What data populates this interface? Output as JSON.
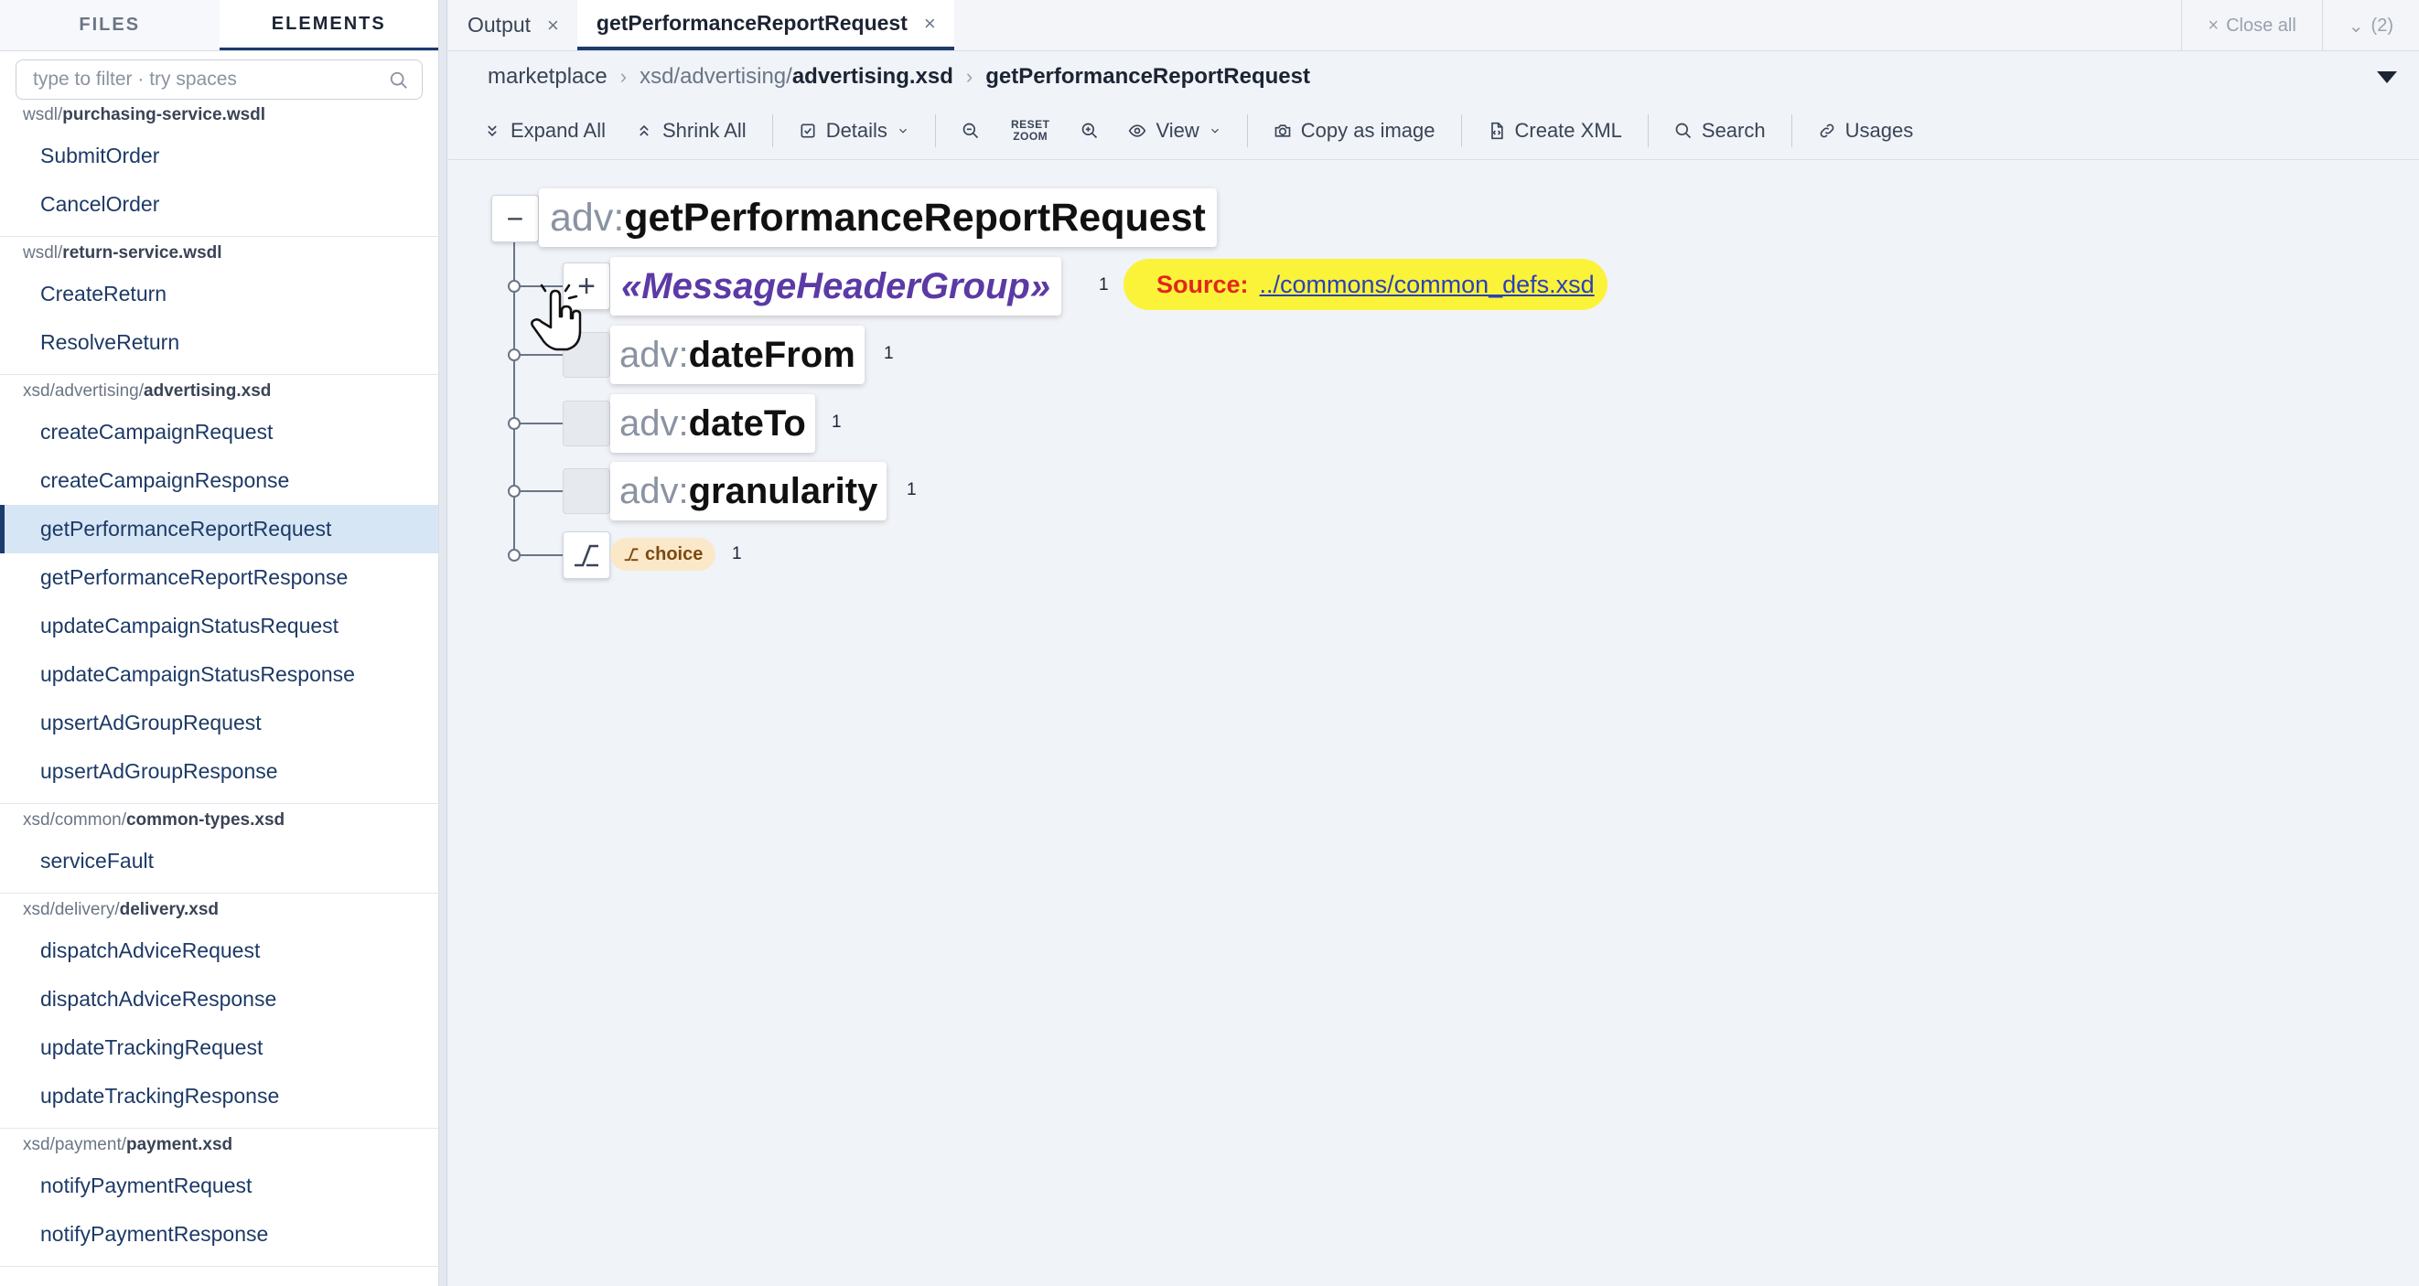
{
  "sidebar": {
    "tabs": [
      {
        "label": "FILES",
        "active": false
      },
      {
        "label": "ELEMENTS",
        "active": true
      }
    ],
    "filter_placeholder": "type to filter · try spaces",
    "groups": [
      {
        "path": "wsdl/",
        "file": "purchasing-service.wsdl",
        "items": [
          "SubmitOrder",
          "CancelOrder"
        ]
      },
      {
        "path": "wsdl/",
        "file": "return-service.wsdl",
        "items": [
          "CreateReturn",
          "ResolveReturn"
        ]
      },
      {
        "path": "xsd/advertising/",
        "file": "advertising.xsd",
        "items": [
          "createCampaignRequest",
          "createCampaignResponse",
          "getPerformanceReportRequest",
          "getPerformanceReportResponse",
          "updateCampaignStatusRequest",
          "updateCampaignStatusResponse",
          "upsertAdGroupRequest",
          "upsertAdGroupResponse"
        ]
      },
      {
        "path": "xsd/common/",
        "file": "common-types.xsd",
        "items": [
          "serviceFault"
        ]
      },
      {
        "path": "xsd/delivery/",
        "file": "delivery.xsd",
        "items": [
          "dispatchAdviceRequest",
          "dispatchAdviceResponse",
          "updateTrackingRequest",
          "updateTrackingResponse"
        ]
      },
      {
        "path": "xsd/payment/",
        "file": "payment.xsd",
        "items": [
          "notifyPaymentRequest",
          "notifyPaymentResponse"
        ]
      }
    ],
    "selected_item": "getPerformanceReportRequest"
  },
  "tabs": [
    {
      "label": "Output",
      "active": false
    },
    {
      "label": "getPerformanceReportRequest",
      "active": true
    }
  ],
  "tabbar_right": {
    "close_all": "Close all",
    "count": "(2)"
  },
  "breadcrumb": {
    "project": "marketplace",
    "path_muted": "xsd/advertising/",
    "path_file": "advertising.xsd",
    "element": "getPerformanceReportRequest"
  },
  "toolbar": {
    "expand_all": "Expand All",
    "shrink_all": "Shrink All",
    "details": "Details",
    "reset_zoom_1": "RESET",
    "reset_zoom_2": "ZOOM",
    "view": "View",
    "copy_as_image": "Copy as image",
    "create_xml": "Create XML",
    "search": "Search",
    "usages": "Usages"
  },
  "diagram": {
    "root": {
      "prefix": "adv:",
      "name": "getPerformanceReportRequest",
      "toggle": "−"
    },
    "group": {
      "name": "«MessageHeaderGroup»",
      "cardinality": "1",
      "toggle": "+"
    },
    "source": {
      "label": "Source:",
      "link": "../commons/common_defs.xsd"
    },
    "children": [
      {
        "prefix": "adv:",
        "name": "dateFrom",
        "cardinality": "1"
      },
      {
        "prefix": "adv:",
        "name": "dateTo",
        "cardinality": "1"
      },
      {
        "prefix": "adv:",
        "name": "granularity",
        "cardinality": "1"
      }
    ],
    "choice": {
      "label": "choice",
      "cardinality": "1"
    }
  },
  "colors": {
    "accent": "#1c3c6e",
    "selected_bg": "#d6e6f5",
    "source_pill": "#fbf339",
    "group_name": "#5b3aa5"
  }
}
